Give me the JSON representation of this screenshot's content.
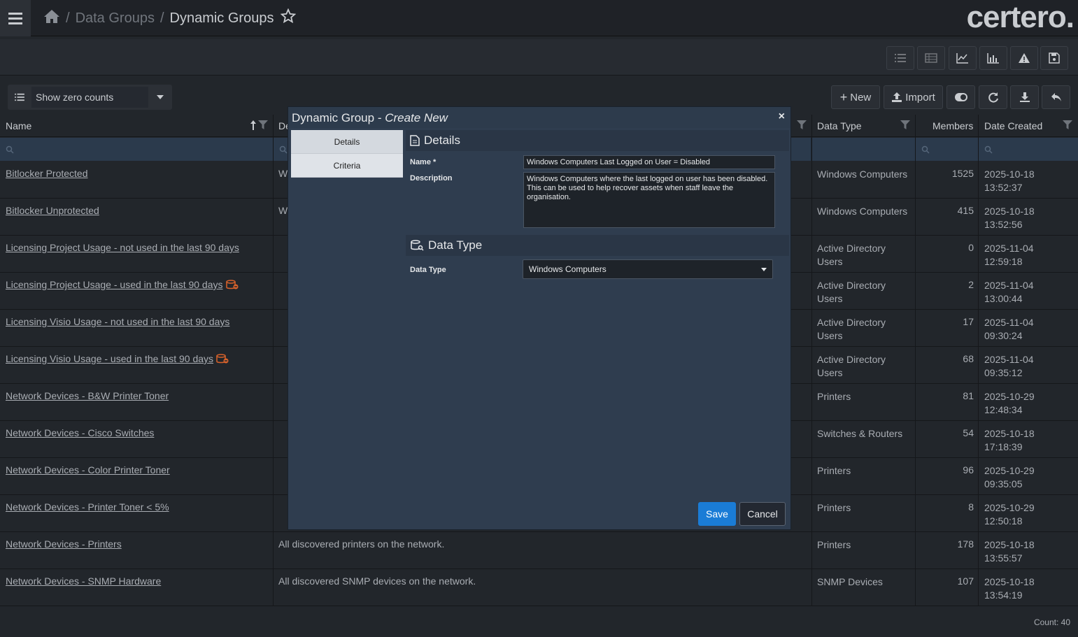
{
  "header": {
    "breadcrumb": [
      "Data Groups",
      "Dynamic Groups"
    ],
    "separator": "/",
    "logo": "certero."
  },
  "filter": {
    "show_zero_counts": "Show zero counts",
    "new_label": "New",
    "import_label": "Import"
  },
  "table": {
    "columns": [
      "Name",
      "De",
      "Data Type",
      "Members",
      "Date Created"
    ],
    "rows": [
      {
        "name": "Bitlocker Protected",
        "desc": "W",
        "dtype": [
          "Windows Computers",
          ""
        ],
        "members": "1525",
        "date": [
          "2025-10-18",
          "13:52:37"
        ],
        "flag": false
      },
      {
        "name": "Bitlocker Unprotected",
        "desc": "W",
        "dtype": [
          "Windows Computers",
          ""
        ],
        "members": "415",
        "date": [
          "2025-10-18",
          "13:52:56"
        ],
        "flag": false
      },
      {
        "name": "Licensing Project Usage - not used in the last 90 days",
        "desc": "",
        "dtype": [
          "Active Directory",
          "Users"
        ],
        "members": "0",
        "date": [
          "2025-11-04",
          "12:59:18"
        ],
        "flag": false
      },
      {
        "name": "Licensing Project Usage - used in the last 90 days",
        "desc": "",
        "dtype": [
          "Active Directory",
          "Users"
        ],
        "members": "2",
        "date": [
          "2025-11-04",
          "13:00:44"
        ],
        "flag": true
      },
      {
        "name": "Licensing Visio Usage - not used in the last 90 days",
        "desc": "",
        "dtype": [
          "Active Directory",
          "Users"
        ],
        "members": "17",
        "date": [
          "2025-11-04",
          "09:30:24"
        ],
        "flag": false
      },
      {
        "name": "Licensing Visio Usage - used in the last 90 days",
        "desc": "",
        "dtype": [
          "Active Directory",
          "Users"
        ],
        "members": "68",
        "date": [
          "2025-11-04",
          "09:35:12"
        ],
        "flag": true
      },
      {
        "name": "Network Devices - B&W Printer Toner",
        "desc": "",
        "dtype": [
          "Printers",
          ""
        ],
        "members": "81",
        "date": [
          "2025-10-29",
          "12:48:34"
        ],
        "flag": false
      },
      {
        "name": "Network Devices - Cisco Switches",
        "desc": "",
        "dtype": [
          "Switches & Routers",
          ""
        ],
        "members": "54",
        "date": [
          "2025-10-18",
          "17:18:39"
        ],
        "flag": false
      },
      {
        "name": "Network Devices - Color Printer Toner",
        "desc": "",
        "dtype": [
          "Printers",
          ""
        ],
        "members": "96",
        "date": [
          "2025-10-29",
          "09:35:05"
        ],
        "flag": false
      },
      {
        "name": "Network Devices - Printer Toner < 5%",
        "desc": "",
        "dtype": [
          "Printers",
          ""
        ],
        "members": "8",
        "date": [
          "2025-10-29",
          "12:50:18"
        ],
        "flag": false
      },
      {
        "name": "Network Devices - Printers",
        "desc": "All discovered printers on the network.",
        "dtype": [
          "Printers",
          ""
        ],
        "members": "178",
        "date": [
          "2025-10-18",
          "13:55:57"
        ],
        "flag": false
      },
      {
        "name": "Network Devices - SNMP Hardware",
        "desc": "All discovered SNMP devices on the network.",
        "dtype": [
          "SNMP Devices",
          ""
        ],
        "members": "107",
        "date": [
          "2025-10-18",
          "13:54:19"
        ],
        "flag": false
      }
    ]
  },
  "footer": {
    "count": "Count: 40"
  },
  "modal": {
    "title_prefix": "Dynamic Group - ",
    "title_mode": "Create New",
    "close": "×",
    "tabs": [
      "Details",
      "Criteria"
    ],
    "details_heading": "Details",
    "name_label": "Name *",
    "name_value": "Windows Computers Last Logged on User = Disabled",
    "description_label": "Description",
    "description_value": "Windows Computers where the last logged on user has been disabled. This can be used to help recover assets when staff leave the organisation.",
    "datatype_heading": "Data Type",
    "datatype_label": "Data Type",
    "datatype_value": "Windows Computers",
    "save": "Save",
    "cancel": "Cancel"
  },
  "colors": {
    "accent": "#1a7cd6",
    "warning_icon": "#d9622b"
  }
}
